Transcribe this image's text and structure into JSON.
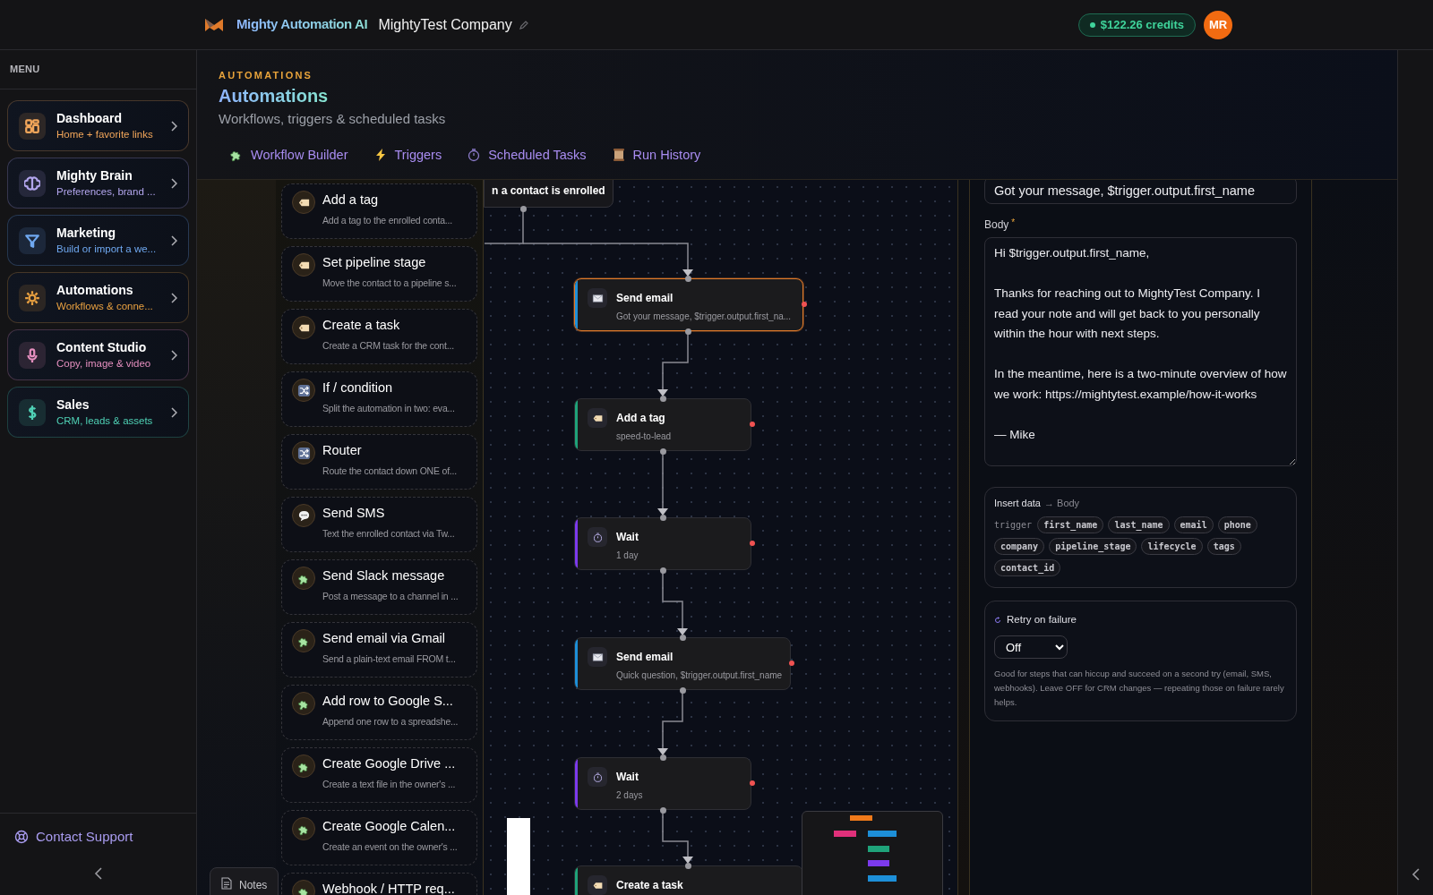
{
  "app": {
    "brand": "Mighty Automation AI",
    "company": "MightyTest Company",
    "credits": "$122.26 credits",
    "avatar": "MR"
  },
  "sidebar": {
    "heading": "MENU",
    "items": [
      {
        "title": "Dashboard",
        "subtitle": "Home + favorite links",
        "kind": "grid",
        "color": "#f2a65a"
      },
      {
        "title": "Mighty Brain",
        "subtitle": "Preferences, brand ...",
        "kind": "brain",
        "color": "#b3a6ee"
      },
      {
        "title": "Marketing",
        "subtitle": "Build or import a we...",
        "kind": "funnel",
        "color": "#6fa8f0"
      },
      {
        "title": "Automations",
        "subtitle": "Workflows & conne...",
        "kind": "gear",
        "color": "#e8a040"
      },
      {
        "title": "Content Studio",
        "subtitle": "Copy, image & video",
        "kind": "mic",
        "color": "#e58fbf"
      },
      {
        "title": "Sales",
        "subtitle": "CRM, leads & assets",
        "kind": "dollar",
        "color": "#4fd1b5"
      }
    ],
    "support": "Contact Support"
  },
  "page": {
    "eyebrow": "AUTOMATIONS",
    "title": "Automations",
    "subtitle": "Workflows, triggers & scheduled tasks"
  },
  "tabs": [
    {
      "label": "Workflow Builder",
      "kind": "puzzle"
    },
    {
      "label": "Triggers",
      "kind": "bolt"
    },
    {
      "label": "Scheduled Tasks",
      "kind": "timer"
    },
    {
      "label": "Run History",
      "kind": "scroll"
    }
  ],
  "palette": [
    {
      "title": "Add a tag",
      "description": "Add a tag to the enrolled conta...",
      "kind": "tag"
    },
    {
      "title": "Set pipeline stage",
      "description": "Move the contact to a pipeline s...",
      "kind": "tag"
    },
    {
      "title": "Create a task",
      "description": "Create a CRM task for the cont...",
      "kind": "tag"
    },
    {
      "title": "If / condition",
      "description": "Split the automation in two: eva...",
      "kind": "shuffle"
    },
    {
      "title": "Router",
      "description": "Route the contact down ONE of...",
      "kind": "shuffle"
    },
    {
      "title": "Send SMS",
      "description": "Text the enrolled contact via Tw...",
      "kind": "chat"
    },
    {
      "title": "Send Slack message",
      "description": "Post a message to a channel in ...",
      "kind": "puzzle"
    },
    {
      "title": "Send email via Gmail",
      "description": "Send a plain-text email FROM t...",
      "kind": "puzzle"
    },
    {
      "title": "Add row to Google S...",
      "description": "Append one row to a spreadshe...",
      "kind": "puzzle"
    },
    {
      "title": "Create Google Drive ...",
      "description": "Create a text file in the owner's ...",
      "kind": "puzzle"
    },
    {
      "title": "Create Google Calen...",
      "description": "Create an event on the owner's ...",
      "kind": "puzzle"
    },
    {
      "title": "Webhook / HTTP req...",
      "kind": "puzzle"
    }
  ],
  "canvas": {
    "trigger": "n a contact is enrolled",
    "nodes": [
      {
        "title": "Send email",
        "detail": "Got your message, $trigger.output.first_na...",
        "kind": "email",
        "selected": true
      },
      {
        "title": "Add a tag",
        "detail": "speed-to-lead",
        "kind": "tag",
        "selected": false
      },
      {
        "title": "Wait",
        "detail": "1 day",
        "kind": "wait",
        "selected": false
      },
      {
        "title": "Send email",
        "detail": "Quick question, $trigger.output.first_name",
        "kind": "email",
        "selected": false
      },
      {
        "title": "Wait",
        "detail": "2 days",
        "kind": "wait",
        "selected": false
      },
      {
        "title": "Create a task",
        "kind": "tag",
        "selected": false
      }
    ],
    "notes": "Notes"
  },
  "editor": {
    "subject": "Got your message, $trigger.output.first_name",
    "body_label": "Body",
    "required_mark": "*",
    "body": "Hi $trigger.output.first_name,\n\nThanks for reaching out to MightyTest Company. I read your note and will get back to you personally within the hour with next steps.\n\nIn the meantime, here is a two-minute overview of how we work: https://mightytest.example/how-it-works\n\n— Mike",
    "insert": {
      "title": "Insert data",
      "target": "→ Body",
      "source": "trigger",
      "fields": [
        "first_name",
        "last_name",
        "email",
        "phone",
        "company",
        "pipeline_stage",
        "lifecycle",
        "tags",
        "contact_id"
      ]
    },
    "retry": {
      "label": "Retry on failure",
      "value": "Off",
      "help": "Good for steps that can hiccup and succeed on a second try (email, SMS, webhooks). Leave OFF for CRM changes — repeating those on failure rarely helps."
    }
  }
}
